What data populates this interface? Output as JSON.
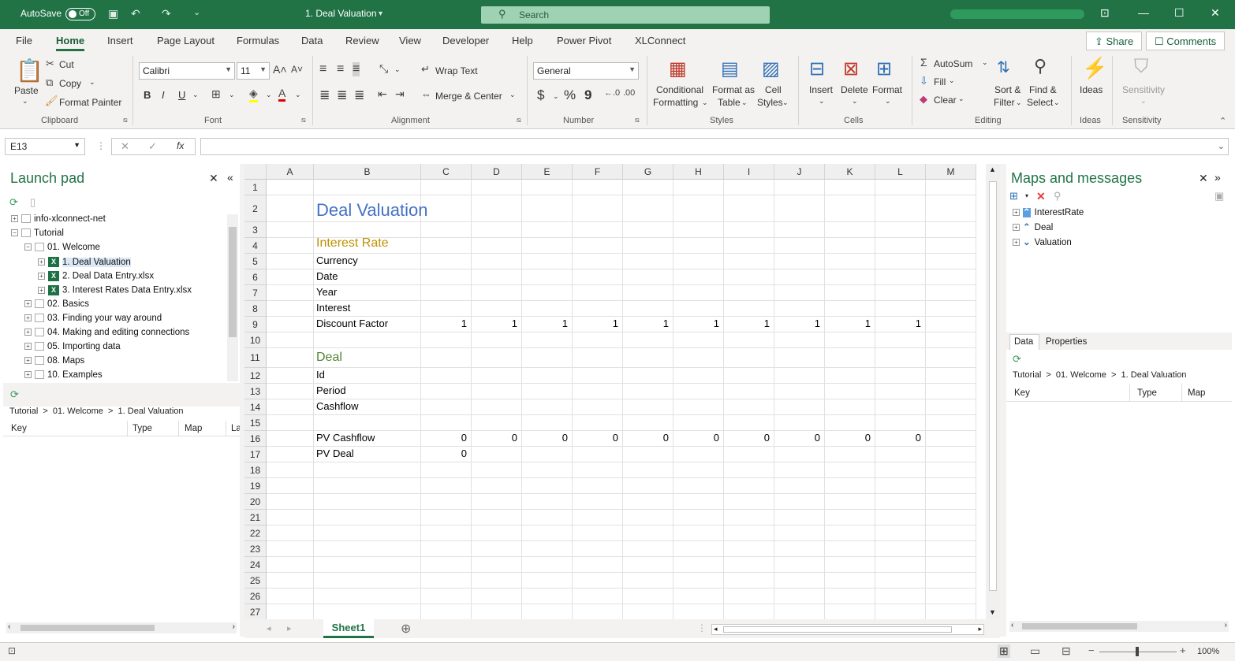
{
  "titlebar": {
    "autosave_label": "AutoSave",
    "autosave_state": "Off",
    "document_title": "1. Deal Valuation",
    "search_placeholder": "Search"
  },
  "menu": {
    "items": [
      "File",
      "Home",
      "Insert",
      "Page Layout",
      "Formulas",
      "Data",
      "Review",
      "View",
      "Developer",
      "Help",
      "Power Pivot",
      "XLConnect"
    ],
    "active": "Home",
    "share_label": "Share",
    "comments_label": "Comments"
  },
  "ribbon": {
    "clipboard": {
      "paste": "Paste",
      "cut": "Cut",
      "copy": "Copy",
      "format_painter": "Format Painter",
      "label": "Clipboard"
    },
    "font": {
      "name": "Calibri",
      "size": "11",
      "bold": "B",
      "italic": "I",
      "underline": "U",
      "label": "Font"
    },
    "alignment": {
      "wrap": "Wrap Text",
      "merge": "Merge & Center",
      "label": "Alignment"
    },
    "number": {
      "format": "General",
      "currency": "$",
      "percent": "%",
      "comma": "9",
      "label": "Number"
    },
    "styles": {
      "conditional_1": "Conditional",
      "conditional_2": "Formatting",
      "format_table_1": "Format as",
      "format_table_2": "Table",
      "cell_styles_1": "Cell",
      "cell_styles_2": "Styles",
      "label": "Styles"
    },
    "cells": {
      "insert": "Insert",
      "delete": "Delete",
      "format": "Format",
      "label": "Cells"
    },
    "editing": {
      "autosum": "AutoSum",
      "fill": "Fill",
      "clear": "Clear",
      "sort_1": "Sort &",
      "sort_2": "Filter",
      "find_1": "Find &",
      "find_2": "Select",
      "label": "Editing"
    },
    "ideas": {
      "button": "Ideas",
      "label": "Ideas"
    },
    "sensitivity": {
      "button": "Sensitivity",
      "label": "Sensitivity"
    }
  },
  "formula_bar": {
    "name_box": "E13",
    "fx": "fx",
    "value": ""
  },
  "launchpad": {
    "title": "Launch pad",
    "tree": [
      {
        "label": "info-xlconnect-net",
        "level": 0,
        "kind": "conn"
      },
      {
        "label": "Tutorial",
        "level": 0,
        "kind": "conn"
      },
      {
        "label": "01. Welcome",
        "level": 1,
        "kind": "folder"
      },
      {
        "label": "1. Deal Valuation",
        "level": 2,
        "kind": "xl",
        "selected": true
      },
      {
        "label": "2. Deal Data Entry.xlsx",
        "level": 2,
        "kind": "xl"
      },
      {
        "label": "3. Interest Rates Data Entry.xlsx",
        "level": 2,
        "kind": "xl"
      },
      {
        "label": "02. Basics",
        "level": 1,
        "kind": "folder"
      },
      {
        "label": "03. Finding your way around",
        "level": 1,
        "kind": "folder"
      },
      {
        "label": "04. Making and editing connections",
        "level": 1,
        "kind": "folder"
      },
      {
        "label": "05. Importing data",
        "level": 1,
        "kind": "folder"
      },
      {
        "label": "08. Maps",
        "level": 1,
        "kind": "folder"
      },
      {
        "label": "10. Examples",
        "level": 1,
        "kind": "folder"
      }
    ],
    "breadcrumb": "Tutorial  >  01. Welcome  >  1. Deal Valuation",
    "columns": [
      "Key",
      "Type",
      "Map",
      "La"
    ]
  },
  "sheet": {
    "columns": [
      {
        "name": "A",
        "width": 60
      },
      {
        "name": "B",
        "width": 136
      },
      {
        "name": "C",
        "width": 64
      },
      {
        "name": "D",
        "width": 64
      },
      {
        "name": "E",
        "width": 64
      },
      {
        "name": "F",
        "width": 64
      },
      {
        "name": "G",
        "width": 64
      },
      {
        "name": "H",
        "width": 64
      },
      {
        "name": "I",
        "width": 64
      },
      {
        "name": "J",
        "width": 64
      },
      {
        "name": "K",
        "width": 64
      },
      {
        "name": "L",
        "width": 64
      },
      {
        "name": "M",
        "width": 64
      }
    ],
    "rows": [
      {
        "n": "1"
      },
      {
        "n": "2",
        "tall": true
      },
      {
        "n": "3"
      },
      {
        "n": "4"
      },
      {
        "n": "5"
      },
      {
        "n": "6"
      },
      {
        "n": "7"
      },
      {
        "n": "8"
      },
      {
        "n": "9"
      },
      {
        "n": "10"
      },
      {
        "n": "11",
        "mid": true
      },
      {
        "n": "12"
      },
      {
        "n": "13"
      },
      {
        "n": "14"
      },
      {
        "n": "15"
      },
      {
        "n": "16"
      },
      {
        "n": "17"
      },
      {
        "n": "18"
      },
      {
        "n": "19"
      },
      {
        "n": "20"
      },
      {
        "n": "21"
      },
      {
        "n": "22"
      },
      {
        "n": "23"
      },
      {
        "n": "24"
      },
      {
        "n": "25"
      },
      {
        "n": "26"
      },
      {
        "n": "27"
      }
    ],
    "cells": [
      {
        "row": 2,
        "col": 1,
        "text": "Deal Valuation",
        "style": "title"
      },
      {
        "row": 4,
        "col": 1,
        "text": "Interest Rate",
        "style": "h-gold"
      },
      {
        "row": 5,
        "col": 1,
        "text": "Currency"
      },
      {
        "row": 6,
        "col": 1,
        "text": "Date"
      },
      {
        "row": 7,
        "col": 1,
        "text": "Year"
      },
      {
        "row": 8,
        "col": 1,
        "text": "Interest"
      },
      {
        "row": 9,
        "col": 1,
        "text": "Discount Factor"
      },
      {
        "row": 9,
        "col": 2,
        "text": "1",
        "num": true
      },
      {
        "row": 9,
        "col": 3,
        "text": "1",
        "num": true
      },
      {
        "row": 9,
        "col": 4,
        "text": "1",
        "num": true
      },
      {
        "row": 9,
        "col": 5,
        "text": "1",
        "num": true
      },
      {
        "row": 9,
        "col": 6,
        "text": "1",
        "num": true
      },
      {
        "row": 9,
        "col": 7,
        "text": "1",
        "num": true
      },
      {
        "row": 9,
        "col": 8,
        "text": "1",
        "num": true
      },
      {
        "row": 9,
        "col": 9,
        "text": "1",
        "num": true
      },
      {
        "row": 9,
        "col": 10,
        "text": "1",
        "num": true
      },
      {
        "row": 9,
        "col": 11,
        "text": "1",
        "num": true
      },
      {
        "row": 11,
        "col": 1,
        "text": "Deal",
        "style": "h-green"
      },
      {
        "row": 12,
        "col": 1,
        "text": "Id"
      },
      {
        "row": 13,
        "col": 1,
        "text": "Period"
      },
      {
        "row": 14,
        "col": 1,
        "text": "Cashflow"
      },
      {
        "row": 16,
        "col": 1,
        "text": "PV Cashflow"
      },
      {
        "row": 16,
        "col": 2,
        "text": "0",
        "num": true
      },
      {
        "row": 16,
        "col": 3,
        "text": "0",
        "num": true
      },
      {
        "row": 16,
        "col": 4,
        "text": "0",
        "num": true
      },
      {
        "row": 16,
        "col": 5,
        "text": "0",
        "num": true
      },
      {
        "row": 16,
        "col": 6,
        "text": "0",
        "num": true
      },
      {
        "row": 16,
        "col": 7,
        "text": "0",
        "num": true
      },
      {
        "row": 16,
        "col": 8,
        "text": "0",
        "num": true
      },
      {
        "row": 16,
        "col": 9,
        "text": "0",
        "num": true
      },
      {
        "row": 16,
        "col": 10,
        "text": "0",
        "num": true
      },
      {
        "row": 16,
        "col": 11,
        "text": "0",
        "num": true
      },
      {
        "row": 17,
        "col": 1,
        "text": "PV Deal"
      },
      {
        "row": 17,
        "col": 2,
        "text": "0",
        "num": true
      }
    ],
    "sheet_tab": "Sheet1"
  },
  "maps_panel": {
    "title": "Maps and messages",
    "items": [
      {
        "label": "InterestRate",
        "selected": true
      },
      {
        "label": "Deal"
      },
      {
        "label": "Valuation"
      }
    ],
    "tabs": [
      "Data",
      "Properties"
    ],
    "breadcrumb": "Tutorial  >  01. Welcome  >  1. Deal Valuation",
    "columns": [
      "Key",
      "Type",
      "Map"
    ]
  },
  "status": {
    "zoom": "100%"
  },
  "colors": {
    "excel_green": "#217346",
    "title_blue": "#4472c4",
    "heading_gold": "#bf9000",
    "heading_green": "#548235"
  }
}
